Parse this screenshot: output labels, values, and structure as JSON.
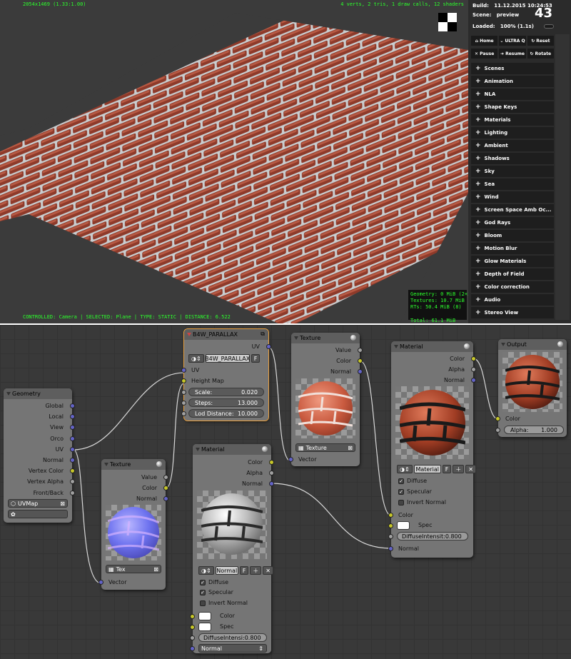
{
  "viewport": {
    "resolution": "2054x1469 (1.33:1.00)",
    "render_stats": "4 verts, 2 tris, 1 draw calls, 12 shaders",
    "status_line": "CONTROLLED: Camera | SELECTED: Plane | TYPE: STATIC | DISTANCE: 6.522",
    "memory": {
      "geometry": "Geometry: 0 MiB (2+2)",
      "textures": "Textures: 10.7 MiB (2)",
      "rts": "RTs: 50.4 MiB (8)",
      "total": "Total: 61.1 MiB"
    }
  },
  "panel": {
    "build_label": "Build:",
    "build_value": "11.12.2015 10:24:53",
    "scene_label": "Scene:",
    "scene_value": "preview",
    "loaded_label": "Loaded:",
    "loaded_value": "100% (1.1s)",
    "fps": "43",
    "controls_row1": [
      "Home",
      "ULTRA Q",
      "Reset"
    ],
    "controls_row2": [
      "Pause",
      "Resume",
      "Rotate"
    ],
    "menu": [
      "Scenes",
      "Animation",
      "NLA",
      "Shape Keys",
      "Materials",
      "Lighting",
      "Ambient",
      "Shadows",
      "Sky",
      "Sea",
      "Wind",
      "Screen Space Amb Oc...",
      "God Rays",
      "Bloom",
      "Motion Blur",
      "Glow Materials",
      "Depth of Field",
      "Color correction",
      "Audio",
      "Stereo View"
    ]
  },
  "nodes": {
    "geometry": {
      "title": "Geometry",
      "outputs": [
        "Global",
        "Local",
        "View",
        "Orco",
        "UV",
        "Normal",
        "Vertex Color",
        "Vertex Alpha",
        "Front/Back"
      ],
      "uvmap": "UVMap"
    },
    "parallax": {
      "title": "B4W_PARALLAX",
      "group_name": "B4W_PARALLAX",
      "f_label": "F",
      "output": "UV",
      "inputs": [
        "UV",
        "Height Map"
      ],
      "scale_label": "Scale:",
      "scale_value": "0.020",
      "steps_label": "Steps:",
      "steps_value": "13.000",
      "lod_label": "Lod Distance:",
      "lod_value": "10.000"
    },
    "texture_normal": {
      "title": "Texture",
      "outputs": [
        "Value",
        "Color",
        "Normal"
      ],
      "tex_name": "Tex",
      "input": "Vector"
    },
    "texture_color": {
      "title": "Texture",
      "outputs": [
        "Value",
        "Color",
        "Normal"
      ],
      "tex_name": "Texture",
      "input": "Vector"
    },
    "material_spec": {
      "title": "Material",
      "outputs": [
        "Color",
        "Alpha",
        "Normal"
      ],
      "mat_name": "Normal",
      "f_label": "F",
      "diffuse": "Diffuse",
      "specular": "Specular",
      "invert": "Invert Normal",
      "in_color": "Color",
      "in_spec": "Spec",
      "diffuse_intensity": "DiffuseIntensi:0.800",
      "normal_select": "Normal"
    },
    "material_main": {
      "title": "Material",
      "outputs": [
        "Color",
        "Alpha",
        "Normal"
      ],
      "mat_name": "Material",
      "f_label": "F",
      "diffuse": "Diffuse",
      "specular": "Specular",
      "invert": "Invert Normal",
      "in_color": "Color",
      "in_spec": "Spec",
      "diffuse_intensity": "DiffuseIntensit:0.800",
      "in_normal": "Normal"
    },
    "output": {
      "title": "Output",
      "in_color": "Color",
      "alpha_label": "Alpha:",
      "alpha_value": "1.000"
    }
  }
}
